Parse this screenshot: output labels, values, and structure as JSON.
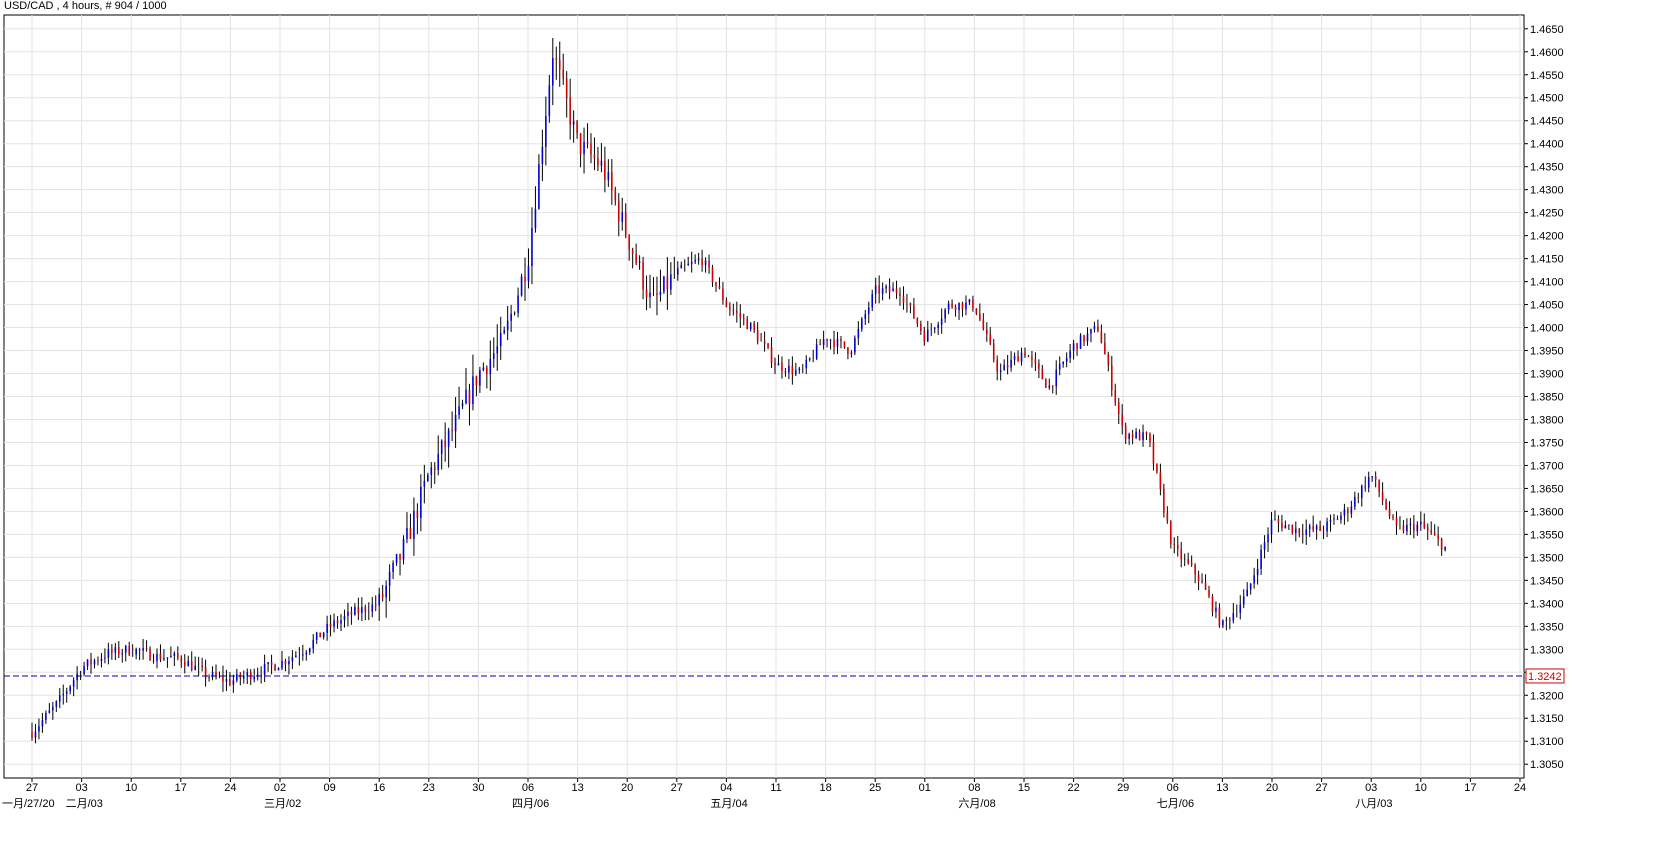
{
  "header": {
    "title": "USD/CAD , 4 hours, # 904 / 1000"
  },
  "colors": {
    "background": "#ffffff",
    "grid": "#e3e3e3",
    "frame": "#000000",
    "bar_default": "#000000",
    "up_candle": "#0000d0",
    "down_candle": "#d00000",
    "current_price_line": "#0000aa",
    "current_price_tag": "#d00000"
  },
  "chart_data": {
    "type": "line",
    "subtype": "ohlc-bars",
    "symbol": "USD/CAD",
    "timeframe": "4 hours",
    "ylim": [
      1.302,
      1.468
    ],
    "yticks": [
      "1.3050",
      "1.3100",
      "1.3150",
      "1.3200",
      "1.3250",
      "1.3300",
      "1.3350",
      "1.3400",
      "1.3450",
      "1.3500",
      "1.3550",
      "1.3600",
      "1.3650",
      "1.3700",
      "1.3750",
      "1.3800",
      "1.3850",
      "1.3900",
      "1.3950",
      "1.4000",
      "1.4050",
      "1.4100",
      "1.4150",
      "1.4200",
      "1.4250",
      "1.4300",
      "1.4350",
      "1.4400",
      "1.4450",
      "1.4500",
      "1.4550",
      "1.4600",
      "1.4650"
    ],
    "x_ticks_day": [
      "27",
      "03",
      "10",
      "17",
      "24",
      "02",
      "09",
      "16",
      "23",
      "30",
      "06",
      "13",
      "20",
      "27",
      "04",
      "11",
      "18",
      "25",
      "01",
      "08",
      "15",
      "22",
      "29",
      "06",
      "13",
      "20",
      "27",
      "03",
      "10",
      "17",
      "24"
    ],
    "x_ticks_month": [
      {
        "label": "一月/27/20",
        "day_index": 0
      },
      {
        "label": "二月/03",
        "day_index": 1
      },
      {
        "label": "三月/02",
        "day_index": 5
      },
      {
        "label": "四月/06",
        "day_index": 10
      },
      {
        "label": "五月/04",
        "day_index": 14
      },
      {
        "label": "六月/08",
        "day_index": 19
      },
      {
        "label": "七月/06",
        "day_index": 23
      },
      {
        "label": "八月/03",
        "day_index": 27
      }
    ],
    "current_price": 1.3242,
    "current_price_label": "1.3242",
    "x": [
      0,
      0.5,
      1,
      1.5,
      2,
      2.5,
      3,
      3.5,
      4,
      4.5,
      5,
      5.5,
      6,
      6.5,
      7,
      7.5,
      8,
      8.5,
      9,
      9.5,
      10,
      10.5,
      11,
      11.5,
      12,
      12.5,
      13,
      13.5,
      14,
      14.5,
      15,
      15.5,
      16,
      16.5,
      17,
      17.5,
      18,
      18.5,
      19,
      19.5,
      20,
      20.5,
      21,
      21.5,
      22,
      22.5,
      23,
      23.5,
      24,
      24.5,
      25,
      25.5,
      26,
      26.5,
      27,
      27.5,
      28,
      28.5
    ],
    "series": [
      {
        "values": [
          1.312,
          1.318,
          1.326,
          1.329,
          1.33,
          1.3285,
          1.328,
          1.3245,
          1.323,
          1.325,
          1.327,
          1.33,
          1.335,
          1.338,
          1.34,
          1.352,
          1.368,
          1.378,
          1.39,
          1.397,
          1.415,
          1.46,
          1.44,
          1.435,
          1.42,
          1.405,
          1.412,
          1.415,
          1.405,
          1.4,
          1.392,
          1.39,
          1.398,
          1.395,
          1.408,
          1.408,
          1.398,
          1.405,
          1.405,
          1.39,
          1.395,
          1.387,
          1.396,
          1.4,
          1.377,
          1.376,
          1.352,
          1.346,
          1.335,
          1.342,
          1.358,
          1.356,
          1.356,
          1.36,
          1.368,
          1.356,
          1.357,
          1.352
        ]
      }
    ]
  }
}
